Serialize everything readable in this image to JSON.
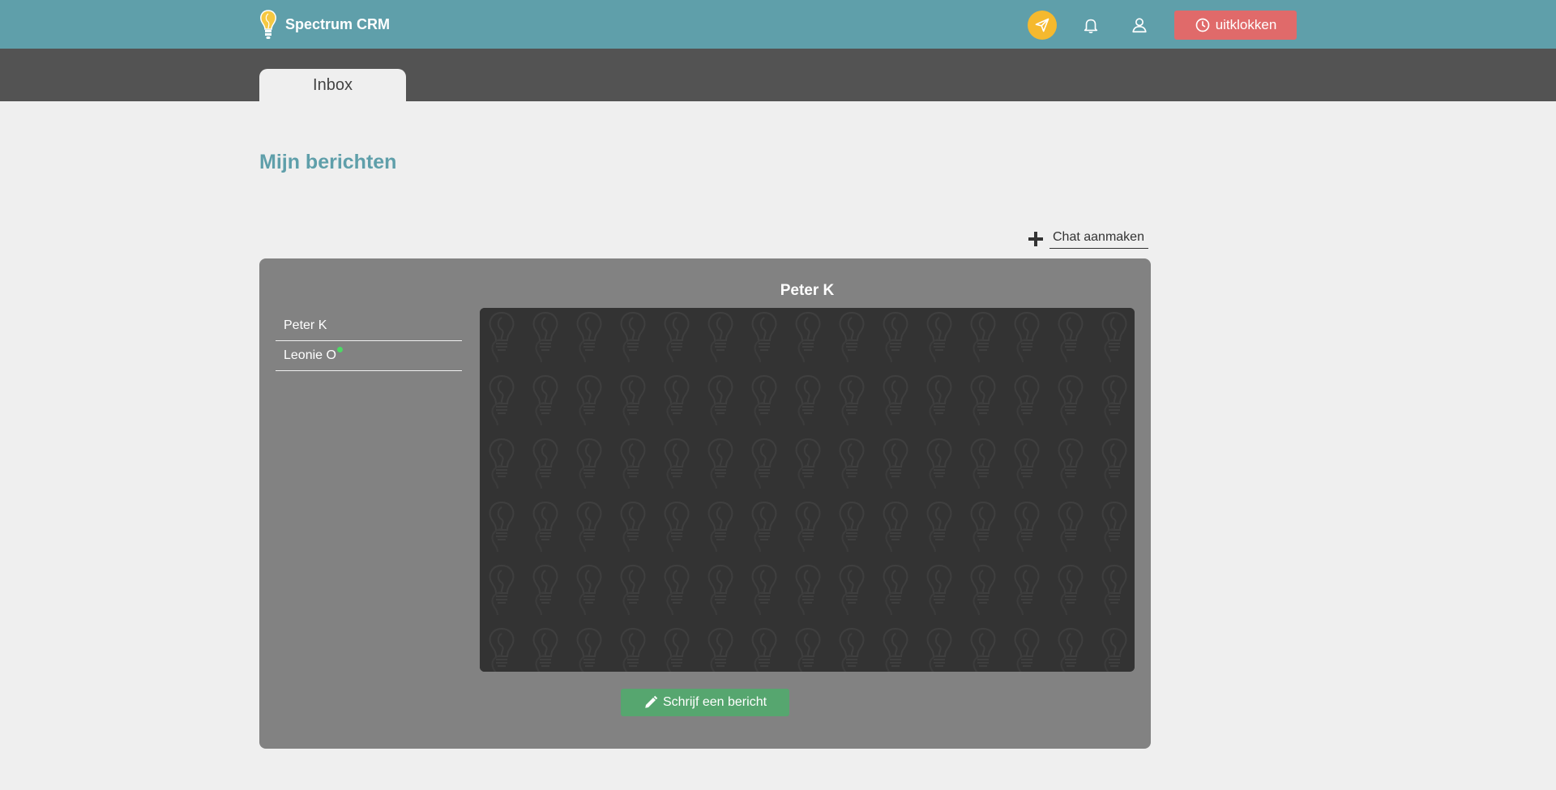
{
  "app": {
    "name": "Spectrum CRM"
  },
  "header": {
    "icons": [
      "send-icon",
      "bell-icon",
      "user-icon"
    ],
    "clockout_label": "uitklokken",
    "colors": {
      "bar": "#5f9faa",
      "send": "#f5b92e",
      "clockout": "#e06a6a"
    }
  },
  "tabs": [
    {
      "label": "Inbox",
      "active": true
    }
  ],
  "page": {
    "title": "Mijn berichten"
  },
  "chat_create": {
    "label": "Chat aanmaken"
  },
  "contacts": [
    {
      "name": "Peter K",
      "online": false
    },
    {
      "name": "Leonie O",
      "online": true
    }
  ],
  "chat": {
    "active_contact": "Peter K",
    "write_label": "Schrijf een bericht",
    "colors": {
      "write": "#56a66f",
      "window": "#333333"
    }
  }
}
